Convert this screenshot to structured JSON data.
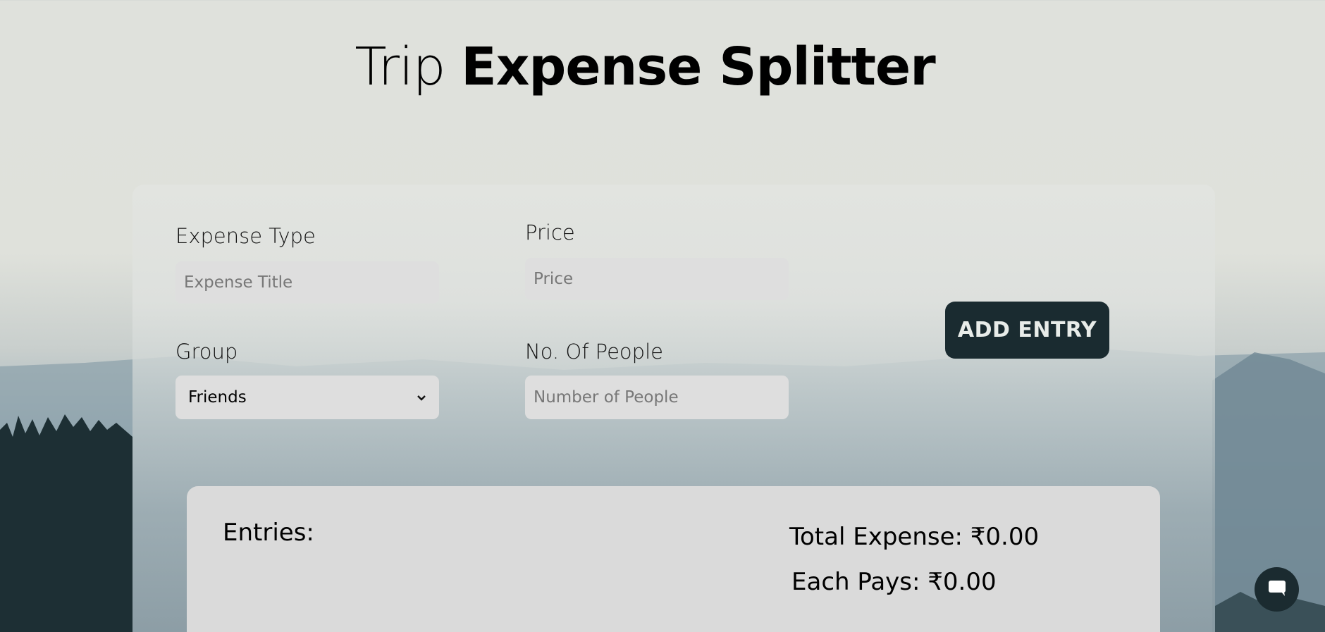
{
  "header": {
    "title_light": "Trip",
    "title_bold": "Expense Splitter"
  },
  "form": {
    "expense_type": {
      "label": "Expense Type",
      "placeholder": "Expense Title",
      "value": ""
    },
    "price": {
      "label": "Price",
      "placeholder": "Price",
      "value": ""
    },
    "group": {
      "label": "Group",
      "selected": "Friends"
    },
    "people": {
      "label": "No. Of People",
      "placeholder": "Number of People",
      "value": ""
    },
    "add_button": "ADD ENTRY"
  },
  "entries": {
    "title": "Entries:",
    "total_expense": "Total Expense: ₹0.00",
    "each_pays": "Each Pays: ₹0.00"
  },
  "icons": {
    "chat": "chat-icon",
    "dropdown": "chevron-down-icon"
  },
  "colors": {
    "button_bg": "#1a2b30",
    "panel_bg": "#dadada",
    "input_bg": "#dedede"
  }
}
